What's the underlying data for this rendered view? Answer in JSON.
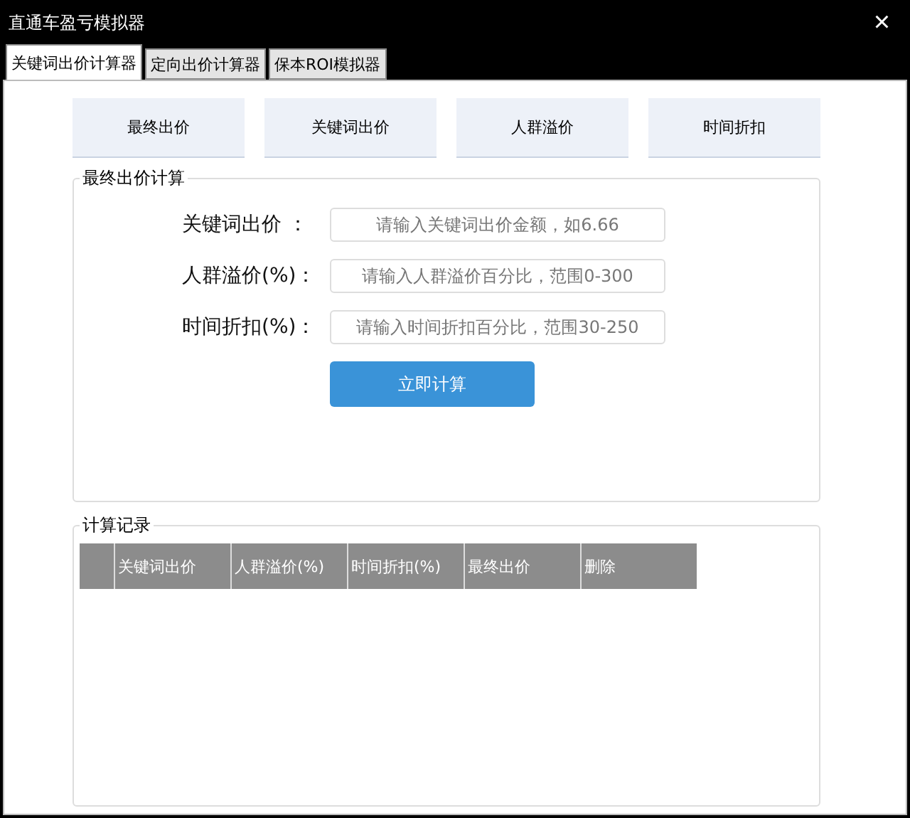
{
  "window": {
    "title": "直通车盈亏模拟器",
    "close": "×"
  },
  "tabs": [
    {
      "label": "关键词出价计算器",
      "selected": true
    },
    {
      "label": "定向出价计算器",
      "selected": false
    },
    {
      "label": "保本ROI模拟器",
      "selected": false
    }
  ],
  "nav_buttons": [
    "最终出价",
    "关键词出价",
    "人群溢价",
    "时间折扣"
  ],
  "calc": {
    "legend": "最终出价计算",
    "fields": [
      {
        "label": "关键词出价 ：",
        "placeholder": "请输入关键词出价金额，如6.66"
      },
      {
        "label": "人群溢价(%)：",
        "placeholder": "请输入人群溢价百分比，范围0-300"
      },
      {
        "label": "时间折扣(%)：",
        "placeholder": "请输入时间折扣百分比，范围30-250"
      }
    ],
    "button": "立即计算"
  },
  "records": {
    "legend": "计算记录",
    "columns": [
      "关键词出价",
      "人群溢价(%)",
      "时间折扣(%)",
      "最终出价",
      "删除"
    ]
  }
}
